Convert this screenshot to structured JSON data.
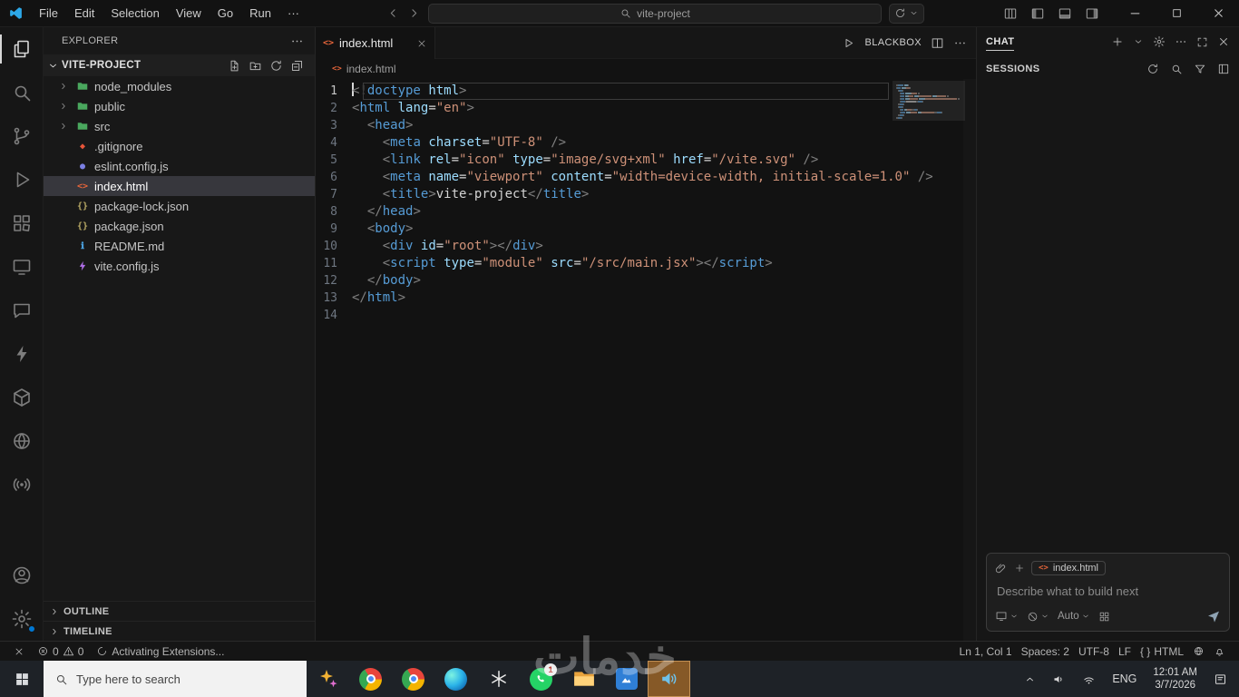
{
  "titlebar": {
    "menus": [
      "File",
      "Edit",
      "Selection",
      "View",
      "Go",
      "Run",
      "···"
    ],
    "search_value": "vite-project"
  },
  "activity_bar": {
    "top": [
      {
        "name": "explorer",
        "icon": "files",
        "active": true
      },
      {
        "name": "search",
        "icon": "search"
      },
      {
        "name": "source-control",
        "icon": "git-branch"
      },
      {
        "name": "run-debug",
        "icon": "debug"
      },
      {
        "name": "extensions",
        "icon": "extensions"
      },
      {
        "name": "remote-explorer",
        "icon": "remote"
      },
      {
        "name": "chat",
        "icon": "chat"
      },
      {
        "name": "thunder-client",
        "icon": "bolt"
      },
      {
        "name": "containers",
        "icon": "cube"
      },
      {
        "name": "python",
        "icon": "pycircle"
      },
      {
        "name": "broadcast",
        "icon": "broadcast"
      }
    ],
    "bottom": [
      {
        "name": "accounts",
        "icon": "account"
      },
      {
        "name": "settings",
        "icon": "gear",
        "badge": true
      }
    ]
  },
  "sidebar": {
    "title": "EXPLORER",
    "project": "VITE-PROJECT",
    "files": [
      {
        "name": "node_modules",
        "kind": "folder"
      },
      {
        "name": "public",
        "kind": "folder"
      },
      {
        "name": "src",
        "kind": "folder"
      },
      {
        "name": ".gitignore",
        "kind": "git"
      },
      {
        "name": "eslint.config.js",
        "kind": "eslint"
      },
      {
        "name": "index.html",
        "kind": "html",
        "selected": true
      },
      {
        "name": "package-lock.json",
        "kind": "json"
      },
      {
        "name": "package.json",
        "kind": "json"
      },
      {
        "name": "README.md",
        "kind": "readme"
      },
      {
        "name": "vite.config.js",
        "kind": "vite"
      }
    ],
    "sections": [
      "OUTLINE",
      "TIMELINE"
    ]
  },
  "editor": {
    "tab_label": "index.html",
    "run_label": "BLACKBOX",
    "breadcrumb": "index.html",
    "code": [
      {
        "tokens": [
          [
            "d",
            "<!"
          ],
          [
            "t",
            "doctype"
          ],
          [
            "p",
            " "
          ],
          [
            "a",
            "html"
          ],
          [
            "d",
            ">"
          ]
        ]
      },
      {
        "tokens": [
          [
            "d",
            "<"
          ],
          [
            "t",
            "html"
          ],
          [
            "p",
            " "
          ],
          [
            "a",
            "lang"
          ],
          [
            "o",
            "="
          ],
          [
            "s",
            "\"en\""
          ],
          [
            "d",
            ">"
          ]
        ]
      },
      {
        "tokens": [
          [
            "p",
            "  "
          ],
          [
            "d",
            "<"
          ],
          [
            "t",
            "head"
          ],
          [
            "d",
            ">"
          ]
        ]
      },
      {
        "tokens": [
          [
            "p",
            "    "
          ],
          [
            "d",
            "<"
          ],
          [
            "t",
            "meta"
          ],
          [
            "p",
            " "
          ],
          [
            "a",
            "charset"
          ],
          [
            "o",
            "="
          ],
          [
            "s",
            "\"UTF-8\""
          ],
          [
            "p",
            " "
          ],
          [
            "d",
            "/>"
          ]
        ]
      },
      {
        "tokens": [
          [
            "p",
            "    "
          ],
          [
            "d",
            "<"
          ],
          [
            "t",
            "link"
          ],
          [
            "p",
            " "
          ],
          [
            "a",
            "rel"
          ],
          [
            "o",
            "="
          ],
          [
            "s",
            "\"icon\""
          ],
          [
            "p",
            " "
          ],
          [
            "a",
            "type"
          ],
          [
            "o",
            "="
          ],
          [
            "s",
            "\"image/svg+xml\""
          ],
          [
            "p",
            " "
          ],
          [
            "a",
            "href"
          ],
          [
            "o",
            "="
          ],
          [
            "s",
            "\"/vite.svg\""
          ],
          [
            "p",
            " "
          ],
          [
            "d",
            "/>"
          ]
        ]
      },
      {
        "tokens": [
          [
            "p",
            "    "
          ],
          [
            "d",
            "<"
          ],
          [
            "t",
            "meta"
          ],
          [
            "p",
            " "
          ],
          [
            "a",
            "name"
          ],
          [
            "o",
            "="
          ],
          [
            "s",
            "\"viewport\""
          ],
          [
            "p",
            " "
          ],
          [
            "a",
            "content"
          ],
          [
            "o",
            "="
          ],
          [
            "s",
            "\"width=device-width, initial-scale=1.0\""
          ],
          [
            "p",
            " "
          ],
          [
            "d",
            "/>"
          ]
        ]
      },
      {
        "tokens": [
          [
            "p",
            "    "
          ],
          [
            "d",
            "<"
          ],
          [
            "t",
            "title"
          ],
          [
            "d",
            ">"
          ],
          [
            "p",
            "vite-project"
          ],
          [
            "d",
            "</"
          ],
          [
            "t",
            "title"
          ],
          [
            "d",
            ">"
          ]
        ]
      },
      {
        "tokens": [
          [
            "p",
            "  "
          ],
          [
            "d",
            "</"
          ],
          [
            "t",
            "head"
          ],
          [
            "d",
            ">"
          ]
        ]
      },
      {
        "tokens": [
          [
            "p",
            "  "
          ],
          [
            "d",
            "<"
          ],
          [
            "t",
            "body"
          ],
          [
            "d",
            ">"
          ]
        ]
      },
      {
        "tokens": [
          [
            "p",
            "    "
          ],
          [
            "d",
            "<"
          ],
          [
            "t",
            "div"
          ],
          [
            "p",
            " "
          ],
          [
            "a",
            "id"
          ],
          [
            "o",
            "="
          ],
          [
            "s",
            "\"root\""
          ],
          [
            "d",
            "></"
          ],
          [
            "t",
            "div"
          ],
          [
            "d",
            ">"
          ]
        ]
      },
      {
        "tokens": [
          [
            "p",
            "    "
          ],
          [
            "d",
            "<"
          ],
          [
            "t",
            "script"
          ],
          [
            "p",
            " "
          ],
          [
            "a",
            "type"
          ],
          [
            "o",
            "="
          ],
          [
            "s",
            "\"module\""
          ],
          [
            "p",
            " "
          ],
          [
            "a",
            "src"
          ],
          [
            "o",
            "="
          ],
          [
            "s",
            "\"/src/main.jsx\""
          ],
          [
            "d",
            "></"
          ],
          [
            "t",
            "script"
          ],
          [
            "d",
            ">"
          ]
        ]
      },
      {
        "tokens": [
          [
            "p",
            "  "
          ],
          [
            "d",
            "</"
          ],
          [
            "t",
            "body"
          ],
          [
            "d",
            ">"
          ]
        ]
      },
      {
        "tokens": [
          [
            "d",
            "</"
          ],
          [
            "t",
            "html"
          ],
          [
            "d",
            ">"
          ]
        ]
      },
      {
        "tokens": []
      }
    ]
  },
  "chat": {
    "title": "CHAT",
    "sessions_label": "SESSIONS",
    "attachment": "index.html",
    "placeholder": "Describe what to build next",
    "auto_label": "Auto"
  },
  "statusbar": {
    "errors": "0",
    "warnings": "0",
    "activity": "Activating Extensions...",
    "cursor": "Ln 1, Col 1",
    "spaces": "Spaces: 2",
    "encoding": "UTF-8",
    "eol": "LF",
    "braces": "{ }",
    "language": "HTML"
  },
  "taskbar": {
    "search_placeholder": "Type here to search",
    "apps": [
      "sparkle",
      "chrome",
      "chrome",
      "edge",
      "chatgpt",
      "whatsapp",
      "files",
      "photos",
      "speaker"
    ],
    "whatsapp_badge": "1",
    "tray_lang": "ENG",
    "time": "12:01 AM",
    "date": "3/7/2026"
  },
  "watermark": "خدمات",
  "colors": {
    "accent": "#0078d4",
    "tag": "#569cd6",
    "attribute": "#9cdcfe",
    "string": "#ce9178",
    "html_icon": "#e6653a"
  }
}
